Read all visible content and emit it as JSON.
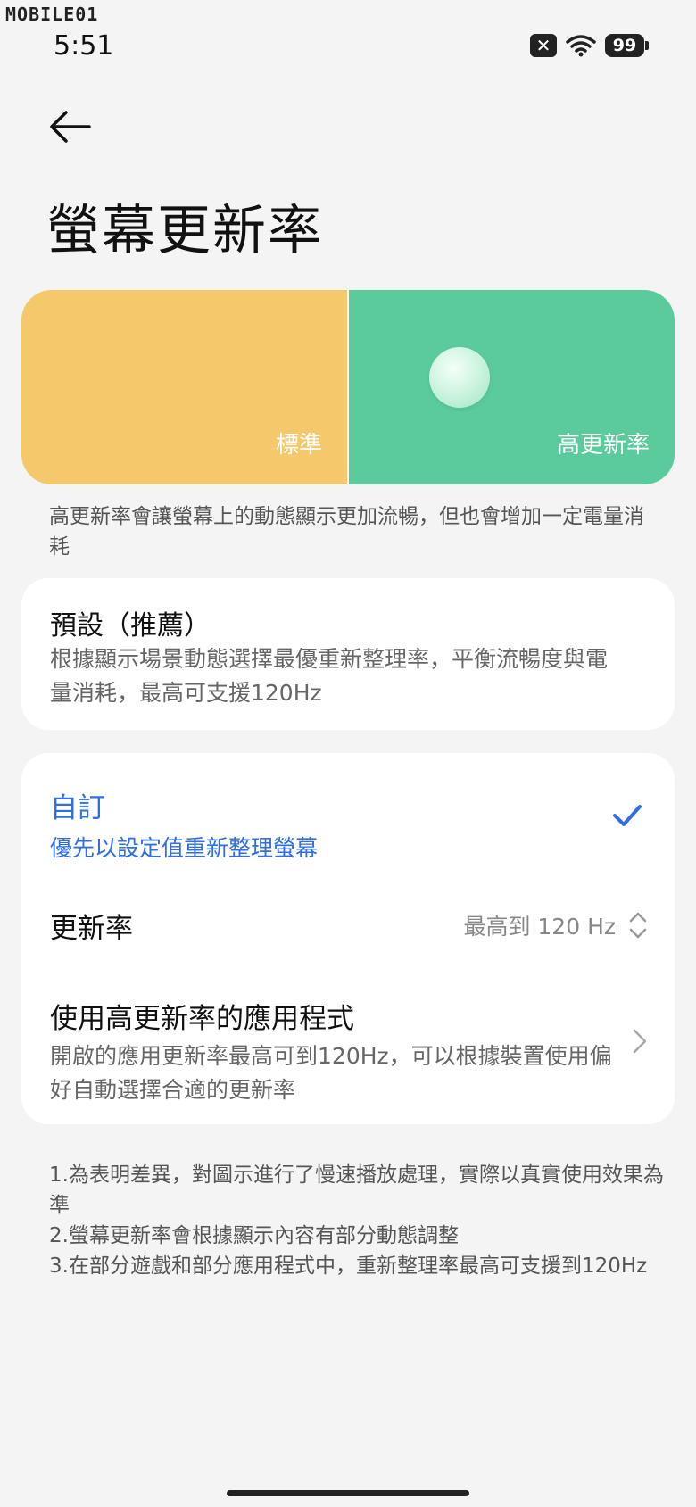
{
  "watermark": "MOBILE01",
  "status": {
    "time": "5:51",
    "x_badge": "✕",
    "battery": "99"
  },
  "page": {
    "title": "螢幕更新率"
  },
  "preview": {
    "left_label": "標準",
    "right_label": "高更新率"
  },
  "description": "高更新率會讓螢幕上的動態顯示更加流暢，但也會增加一定電量消耗",
  "options": {
    "default": {
      "title": "預設（推薦）",
      "subtitle": "根據顯示場景動態選擇最優重新整理率，平衡流暢度與電量消耗，最高可支援120Hz"
    },
    "custom": {
      "title": "自訂",
      "subtitle": "優先以設定值重新整理螢幕",
      "selected": true
    }
  },
  "refresh_rate": {
    "label": "更新率",
    "value": "最高到 120 Hz"
  },
  "high_rate_apps": {
    "title": "使用高更新率的應用程式",
    "subtitle": "開啟的應用更新率最高可到120Hz，可以根據裝置使用偏好自動選擇合適的更新率"
  },
  "notes": [
    "1.為表明差異，對圖示進行了慢速播放處理，實際以真實使用效果為準",
    "2.螢幕更新率會根據顯示內容有部分動態調整",
    "3.在部分遊戲和部分應用程式中，重新整理率最高可支援到120Hz"
  ],
  "colors": {
    "standard": "#f5c86b",
    "high": "#5ccb9c",
    "accent": "#2f6fe3"
  }
}
